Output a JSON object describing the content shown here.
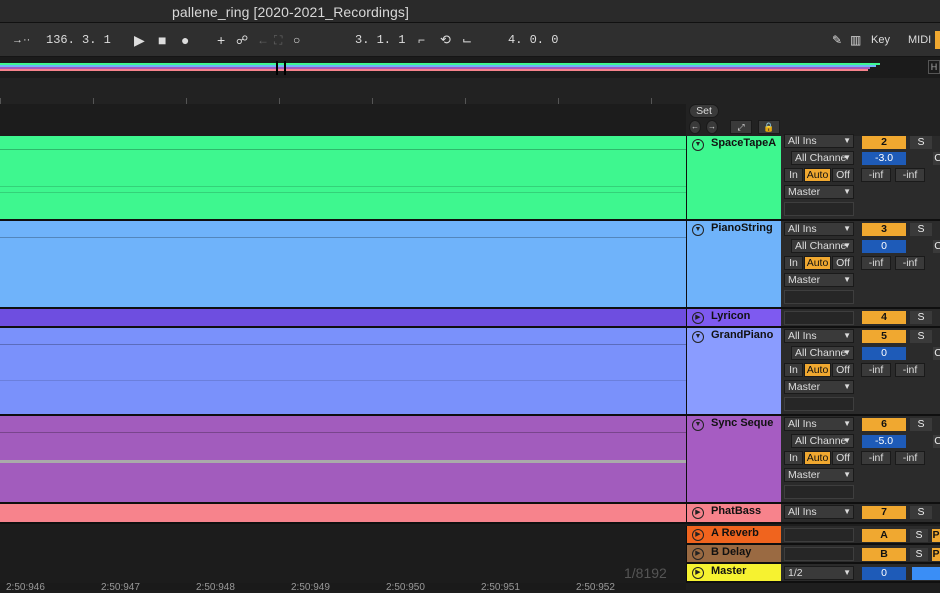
{
  "window": {
    "title": "pallene_ring  [2020-2021_Recordings]"
  },
  "transport": {
    "position": "136.  3.  1",
    "loop_start": "3.  1.  1",
    "loop_length": "4.  0.  0",
    "key_label": "Key",
    "midi_label": "MIDI"
  },
  "set_button": "Set",
  "timeline": {
    "labels": [
      "2:50:946",
      "2:50:947",
      "2:50:948",
      "2:50:949",
      "2:50:950",
      "2:50:951",
      "2:50:952"
    ],
    "grid_display": "1/8192"
  },
  "tracks": [
    {
      "name": "SpaceTapeA",
      "color": "#3ef78f",
      "hdr_color": "#3ef78f",
      "type": "audio",
      "input": "All Ins",
      "channel": "All Channe",
      "monitor": [
        "In",
        "Auto",
        "Off"
      ],
      "output": "Master",
      "number": "2",
      "volume": "-3.0",
      "peak_l": "-inf",
      "peak_r": "-inf",
      "solo": "S"
    },
    {
      "name": "PianoString",
      "color": "#6fb3fa",
      "hdr_color": "#6fb3fa",
      "type": "midi",
      "input": "All Ins",
      "channel": "All Channe",
      "monitor": [
        "In",
        "Auto",
        "Off"
      ],
      "output": "Master",
      "number": "3",
      "volume": "0",
      "peak_l": "-inf",
      "peak_r": "-inf",
      "solo": "S"
    },
    {
      "name": "Lyricon",
      "color": "#6e4ee0",
      "hdr_color": "#7e5af0",
      "type": "group",
      "number": "4",
      "solo": "S"
    },
    {
      "name": "GrandPiano",
      "color": "#7a91fb",
      "hdr_color": "#8a9cff",
      "type": "midi",
      "input": "All Ins",
      "channel": "All Channe",
      "monitor": [
        "In",
        "Auto",
        "Off"
      ],
      "output": "Master",
      "number": "5",
      "volume": "0",
      "peak_l": "-inf",
      "peak_r": "-inf",
      "solo": "S"
    },
    {
      "name": "Sync Seque",
      "color": "#a25cbd",
      "hdr_color": "#a65cc2",
      "type": "midi",
      "input": "All Ins",
      "channel": "All Channe",
      "monitor": [
        "In",
        "Auto",
        "Off"
      ],
      "output": "Master",
      "number": "6",
      "volume": "-5.0",
      "peak_l": "-inf",
      "peak_r": "-inf",
      "solo": "S"
    },
    {
      "name": "PhatBass",
      "color": "#f7838c",
      "hdr_color": "#f7838c",
      "type": "collapsed",
      "input": "All Ins",
      "number": "7",
      "solo": "S"
    }
  ],
  "returns": [
    {
      "name": "A Reverb",
      "color": "#f0641e",
      "number": "A",
      "solo": "S",
      "pre": "P"
    },
    {
      "name": "B Delay",
      "color": "#9a6a42",
      "number": "B",
      "solo": "S",
      "pre": "P"
    }
  ],
  "master": {
    "name": "Master",
    "color": "#f6f230",
    "cue": "1/2",
    "volume": "0"
  }
}
